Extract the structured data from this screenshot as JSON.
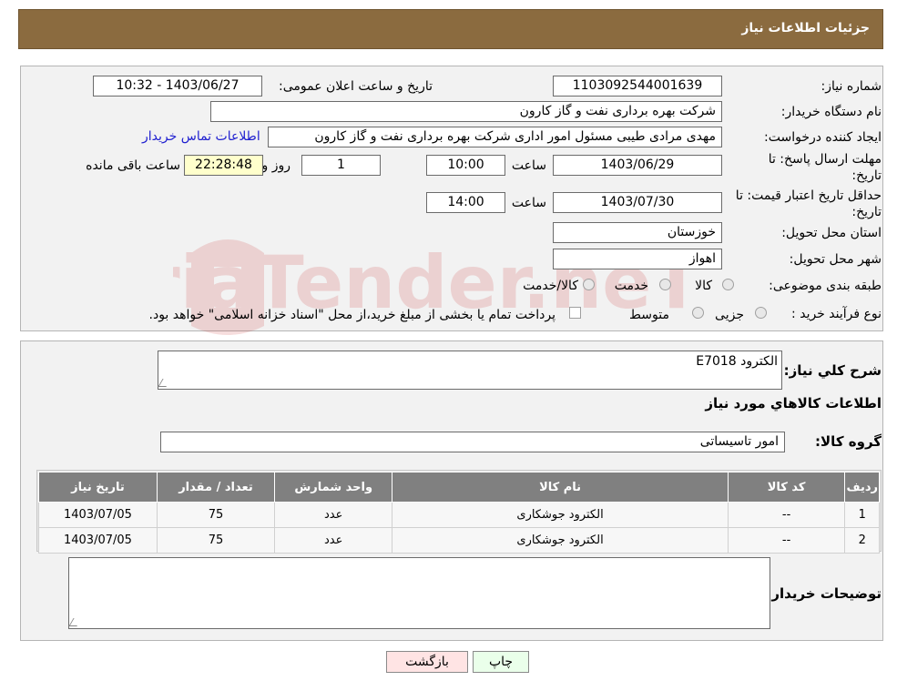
{
  "header": {
    "title": "جزئیات اطلاعات نیاز"
  },
  "form": {
    "need_number_label": "شماره نیاز:",
    "need_number": "1103092544001639",
    "announce_label": "تاریخ و ساعت اعلان عمومی:",
    "announce_value": "1403/06/27 - 10:32",
    "buyer_org_label": "نام دستگاه خریدار:",
    "buyer_org": "شرکت بهره برداری نفت و گاز کارون",
    "creator_label": "ایجاد کننده درخواست:",
    "creator": "مهدی مرادی طیبی مسئول امور اداری شرکت بهره برداری نفت و گاز کارون",
    "contact_link": "اطلاعات تماس خریدار",
    "deadline_label_1": "مهلت ارسال پاسخ: تا",
    "deadline_label_2": "تاریخ:",
    "deadline_date": "1403/06/29",
    "time_label": "ساعت",
    "deadline_time": "10:00",
    "days_value": "1",
    "days_label": "روز و",
    "remaining_time": "22:28:48",
    "remaining_label": "ساعت باقی مانده",
    "validity_label_1": "حداقل تاریخ اعتبار قیمت: تا",
    "validity_label_2": "تاریخ:",
    "validity_date": "1403/07/30",
    "validity_time": "14:00",
    "province_label": "استان محل تحویل:",
    "province": "خوزستان",
    "city_label": "شهر محل تحویل:",
    "city": "اهواز",
    "category_label": "طبقه بندی موضوعی:",
    "category_options": [
      "کالا",
      "خدمت",
      "کالا/خدمت"
    ],
    "process_label": "نوع فرآیند خرید :",
    "process_options": [
      "جزیی",
      "متوسط"
    ],
    "payment_note": "پرداخت تمام یا بخشی از مبلغ خرید،از محل \"اسناد خزانه اسلامی\" خواهد بود."
  },
  "details": {
    "summary_label": "شرح کلي نياز:",
    "summary": "الکترود E7018",
    "goods_info_title": "اطلاعات کالاهاي مورد نياز",
    "group_label": "گروه کالا:",
    "group": "امور تاسیساتی",
    "table": {
      "headers": [
        "رديف",
        "کد کالا",
        "نام کالا",
        "واحد شمارش",
        "تعداد / مقدار",
        "تاريخ نياز"
      ],
      "rows": [
        [
          "1",
          "--",
          "الکترود جوشکاری",
          "عدد",
          "75",
          "1403/07/05"
        ],
        [
          "2",
          "--",
          "الکترود جوشکاری",
          "عدد",
          "75",
          "1403/07/05"
        ]
      ]
    },
    "buyer_notes_label": "توضیحات خریدار:",
    "buyer_notes": ""
  },
  "buttons": {
    "print": "چاپ",
    "back": "بازگشت"
  },
  "watermark": {
    "text": "AriaTender.neT"
  },
  "colors": {
    "header": "#8b6b3f",
    "table_header": "#808080",
    "time_box": "#ffffcc",
    "back_button": "#ffe4e4",
    "print_button": "#eaffea"
  }
}
